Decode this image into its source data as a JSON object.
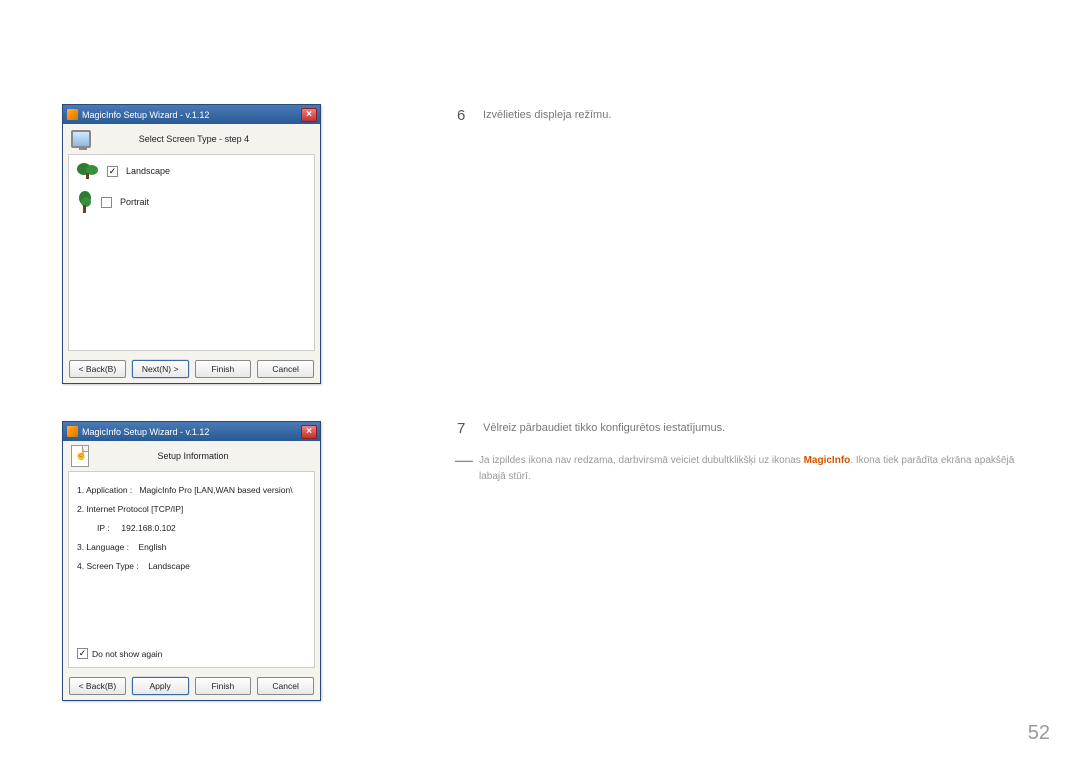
{
  "instructions": {
    "step6_num": "6",
    "step6_text": "Izvēlieties displeja režīmu.",
    "step7_num": "7",
    "step7_text": "Vēlreiz pārbaudiet tikko konfigurētos iestatījumus."
  },
  "note": {
    "text_before": "Ja izpildes ikona nav redzama, darbvirsmā veiciet dubultklikšķi uz ikonas ",
    "highlight": "MagicInfo",
    "text_after": ". Ikona tiek parādīta ekrāna apakšējā labajā stūrī."
  },
  "page_number": "52",
  "wizard1": {
    "title": "MagicInfo Setup Wizard - v.1.12",
    "header": "Select Screen Type - step 4",
    "landscape_label": "Landscape",
    "landscape_checked": true,
    "portrait_label": "Portrait",
    "portrait_checked": false,
    "buttons": {
      "back": "< Back(B)",
      "next": "Next(N) >",
      "finish": "Finish",
      "cancel": "Cancel"
    }
  },
  "wizard2": {
    "title": "MagicInfo Setup Wizard - v.1.12",
    "header": "Setup Information",
    "info": {
      "line1_label": "1. Application :",
      "line1_value": "MagicInfo Pro [LAN,WAN based version\\",
      "line2_label": "2. Internet Protocol [TCP/IP]",
      "ip_label": "IP :",
      "ip_value": "192.168.0.102",
      "line3_label": "3. Language :",
      "line3_value": "English",
      "line4_label": "4. Screen Type :",
      "line4_value": "Landscape"
    },
    "dont_show_label": "Do not show again",
    "dont_show_checked": true,
    "buttons": {
      "back": "< Back(B)",
      "apply": "Apply",
      "finish": "Finish",
      "cancel": "Cancel"
    }
  }
}
